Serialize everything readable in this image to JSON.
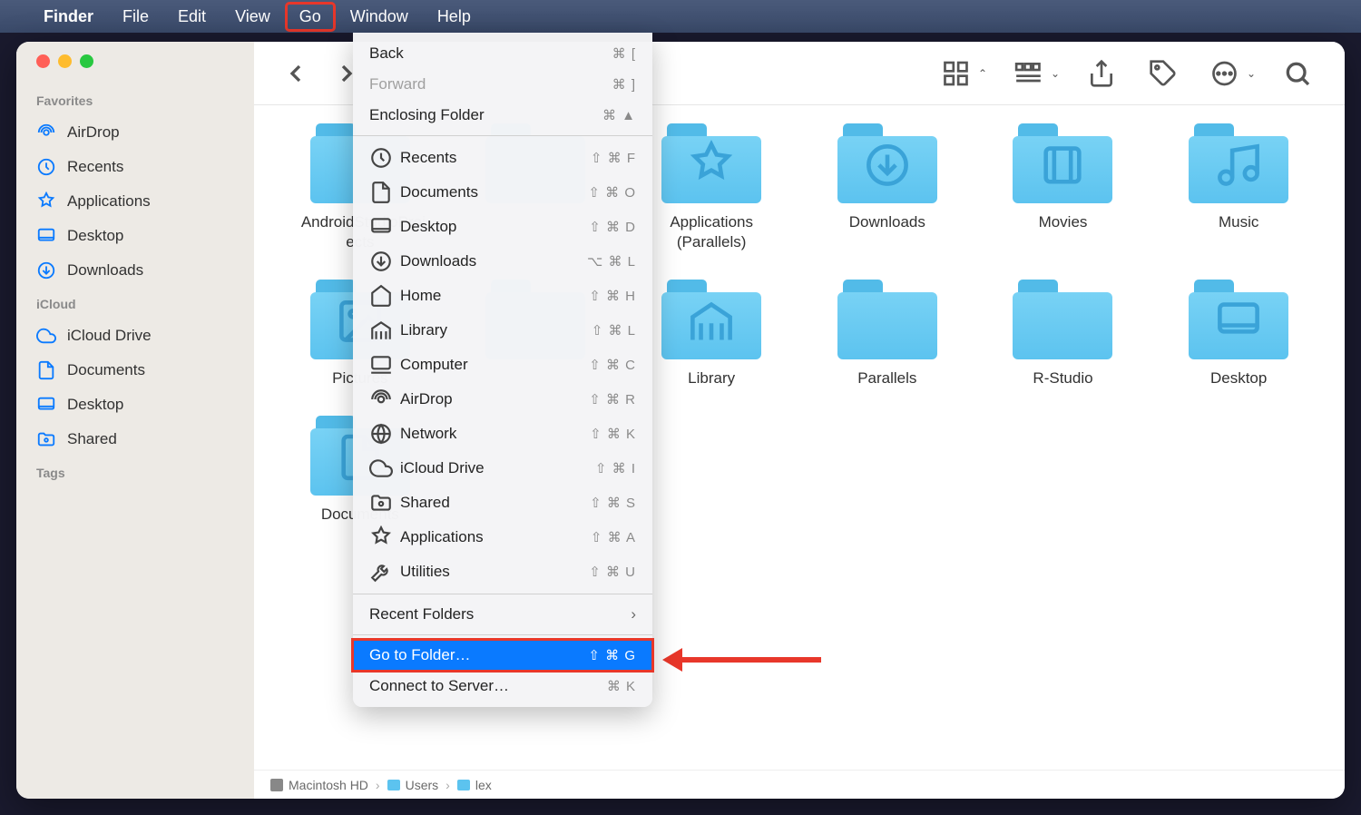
{
  "menubar": {
    "app_name": "Finder",
    "items": [
      "File",
      "Edit",
      "View",
      "Go",
      "Window",
      "Help"
    ],
    "highlighted": "Go"
  },
  "sidebar": {
    "sections": [
      {
        "header": "Favorites",
        "items": [
          {
            "icon": "airdrop",
            "label": "AirDrop"
          },
          {
            "icon": "clock",
            "label": "Recents"
          },
          {
            "icon": "app",
            "label": "Applications"
          },
          {
            "icon": "desktop",
            "label": "Desktop"
          },
          {
            "icon": "download",
            "label": "Downloads"
          }
        ]
      },
      {
        "header": "iCloud",
        "items": [
          {
            "icon": "cloud",
            "label": "iCloud Drive"
          },
          {
            "icon": "doc",
            "label": "Documents"
          },
          {
            "icon": "desktop",
            "label": "Desktop"
          },
          {
            "icon": "shared",
            "label": "Shared"
          }
        ]
      },
      {
        "header": "Tags",
        "items": []
      }
    ]
  },
  "folders": [
    {
      "label": "AndroidStudioProj ects",
      "glyph": ""
    },
    {
      "label": "",
      "glyph": ""
    },
    {
      "label": "Applications (Parallels)",
      "glyph": "app"
    },
    {
      "label": "Downloads",
      "glyph": "download"
    },
    {
      "label": "Movies",
      "glyph": "movie"
    },
    {
      "label": "Music",
      "glyph": "music"
    },
    {
      "label": "Pictures",
      "glyph": "picture"
    },
    {
      "label": "",
      "glyph": ""
    },
    {
      "label": "Library",
      "glyph": "library"
    },
    {
      "label": "Parallels",
      "glyph": ""
    },
    {
      "label": "R-Studio",
      "glyph": ""
    },
    {
      "label": "Desktop",
      "glyph": "desktop"
    },
    {
      "label": "Documents",
      "glyph": "doc"
    }
  ],
  "dropdown": {
    "groups": [
      [
        {
          "label": "Back",
          "shortcut": "⌘ [",
          "disabled": false
        },
        {
          "label": "Forward",
          "shortcut": "⌘ ]",
          "disabled": true
        },
        {
          "label": "Enclosing Folder",
          "shortcut": "⌘ ▲",
          "disabled": false
        }
      ],
      [
        {
          "icon": "clock",
          "label": "Recents",
          "shortcut": "⇧ ⌘ F"
        },
        {
          "icon": "doc",
          "label": "Documents",
          "shortcut": "⇧ ⌘ O"
        },
        {
          "icon": "desktop",
          "label": "Desktop",
          "shortcut": "⇧ ⌘ D"
        },
        {
          "icon": "download",
          "label": "Downloads",
          "shortcut": "⌥ ⌘ L"
        },
        {
          "icon": "home",
          "label": "Home",
          "shortcut": "⇧ ⌘ H"
        },
        {
          "icon": "library",
          "label": "Library",
          "shortcut": "⇧ ⌘ L"
        },
        {
          "icon": "computer",
          "label": "Computer",
          "shortcut": "⇧ ⌘ C"
        },
        {
          "icon": "airdrop",
          "label": "AirDrop",
          "shortcut": "⇧ ⌘ R"
        },
        {
          "icon": "network",
          "label": "Network",
          "shortcut": "⇧ ⌘ K"
        },
        {
          "icon": "cloud",
          "label": "iCloud Drive",
          "shortcut": "⇧ ⌘ I"
        },
        {
          "icon": "shared",
          "label": "Shared",
          "shortcut": "⇧ ⌘ S"
        },
        {
          "icon": "app",
          "label": "Applications",
          "shortcut": "⇧ ⌘ A"
        },
        {
          "icon": "utilities",
          "label": "Utilities",
          "shortcut": "⇧ ⌘ U"
        }
      ],
      [
        {
          "label": "Recent Folders",
          "arrow": true
        }
      ],
      [
        {
          "label": "Go to Folder…",
          "shortcut": "⇧ ⌘ G",
          "selected": true,
          "outlined": true
        },
        {
          "label": "Connect to Server…",
          "shortcut": "⌘ K"
        }
      ]
    ]
  },
  "pathbar": {
    "segments": [
      "Macintosh HD",
      "Users",
      "lex"
    ]
  }
}
